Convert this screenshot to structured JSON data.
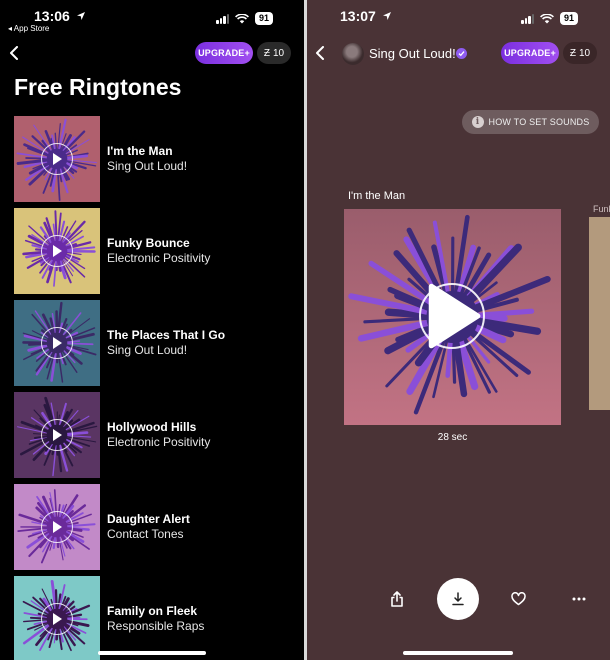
{
  "left_screen": {
    "status": {
      "time": "13:06",
      "back_app": "◂ App Store",
      "battery": "91"
    },
    "header": {
      "upgrade_label": "UPGRADE+",
      "z_symbol": "Ƶ",
      "z_count": "10"
    },
    "title": "Free Ringtones",
    "ringtones": [
      {
        "title": "I'm the Man",
        "artist": "Sing Out Loud!",
        "bg": "#b0606e",
        "art": "#4a2a8a"
      },
      {
        "title": "Funky Bounce",
        "artist": "Electronic Positivity",
        "bg": "#d9c37a",
        "art": "#6a2aa8"
      },
      {
        "title": "The Places That I Go",
        "artist": "Sing Out Loud!",
        "bg": "#3f6e84",
        "art": "#3a2a66"
      },
      {
        "title": "Hollywood Hills",
        "artist": "Electronic Positivity",
        "bg": "#5a3563",
        "art": "#2a1840"
      },
      {
        "title": "Daughter Alert",
        "artist": "Contact Tones",
        "bg": "#c28ac8",
        "art": "#6a2a9a"
      },
      {
        "title": "Family on Fleek",
        "artist": "Responsible Raps",
        "bg": "#7ec9c7",
        "art": "#3a1850"
      }
    ]
  },
  "right_screen": {
    "status": {
      "time": "13:07",
      "battery": "91"
    },
    "header": {
      "artist": "Sing Out Loud!",
      "upgrade_label": "UPGRADE+",
      "z_symbol": "Ƶ",
      "z_count": "10"
    },
    "how_to_label": "HOW TO SET SOUNDS",
    "info_glyph": "i",
    "card": {
      "title": "I'm the Man",
      "duration": "28 sec"
    },
    "next_card_title": "Funk",
    "actions": [
      "share-icon",
      "download-icon",
      "heart-icon",
      "more-icon"
    ]
  },
  "colors": {
    "upgrade_gradient_start": "#7b2fe0",
    "upgrade_gradient_end": "#a14ff0",
    "right_bg": "#4a3336"
  }
}
